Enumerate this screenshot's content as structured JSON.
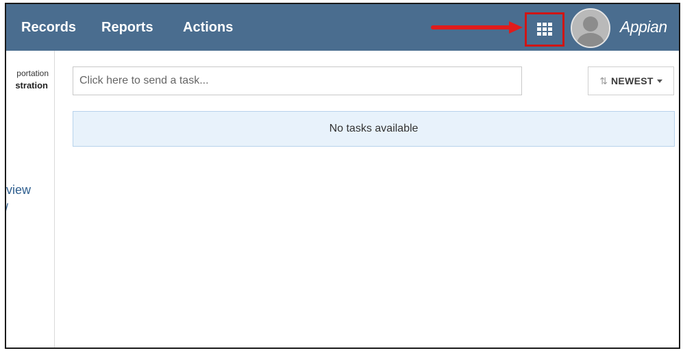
{
  "topnav": {
    "items": [
      {
        "label": "Records"
      },
      {
        "label": "Reports"
      },
      {
        "label": "Actions"
      }
    ],
    "brand": "Appian",
    "apps_icon": "grid-icon",
    "avatar_icon": "user-silhouette-icon",
    "background_color": "#4a6d8f"
  },
  "annotation": {
    "arrow_color": "#e01b1b",
    "highlight_color": "#d01515"
  },
  "sidebar": {
    "text_line1": "portation",
    "text_line2": "stration",
    "link1": "view",
    "link2": "/"
  },
  "tasks": {
    "input_value": "",
    "input_placeholder": "Click here to send a task...",
    "sort_icon": "sort-arrows-icon",
    "sort_label": "NEWEST",
    "empty_message": "No tasks available",
    "panel_color": "#e8f2fb"
  }
}
